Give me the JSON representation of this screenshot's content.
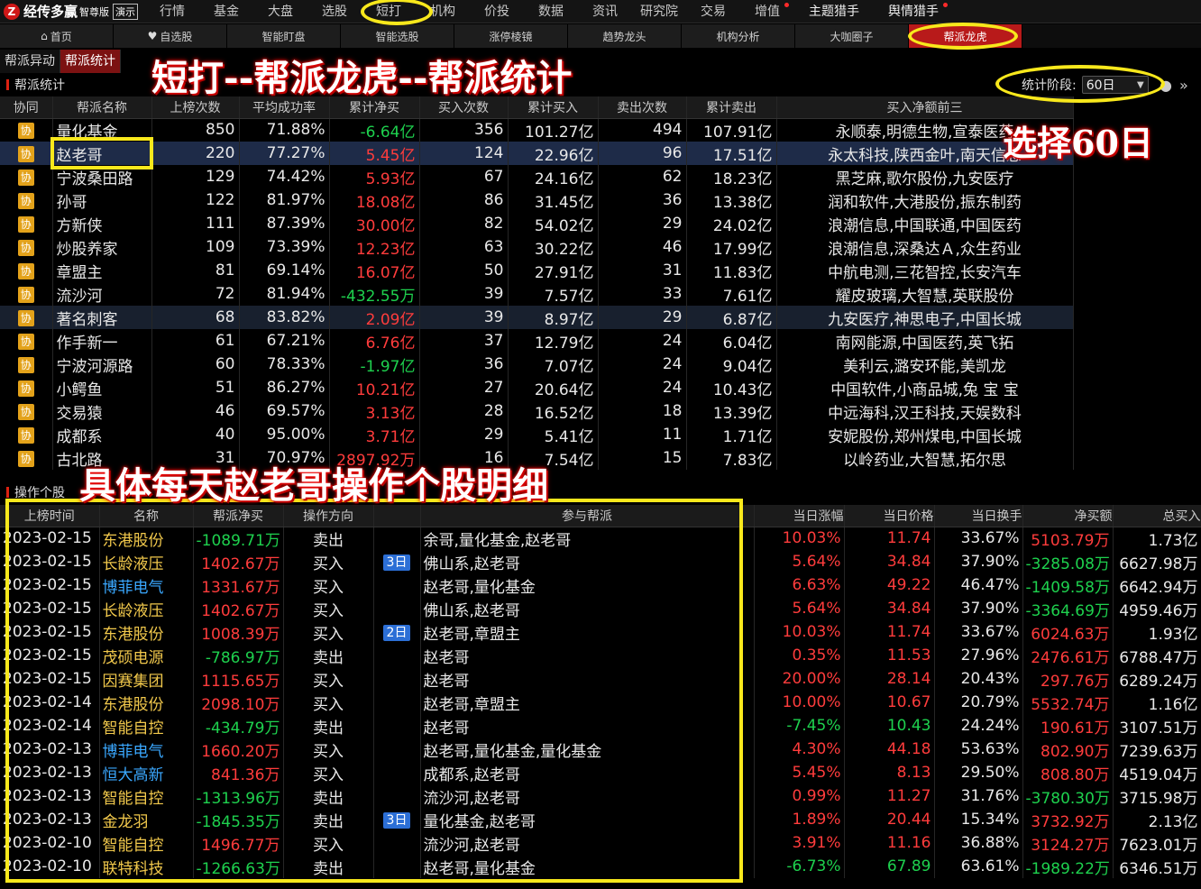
{
  "app": {
    "logo_glyph": "Z",
    "name": "经传多赢",
    "edition": "智尊版",
    "demo": "演示"
  },
  "menu": [
    "行情",
    "基金",
    "大盘",
    "选股",
    "短打",
    "机构",
    "价投",
    "数据",
    "资讯",
    "研究院",
    "交易",
    "增值",
    "主题猎手",
    "舆情猎手"
  ],
  "tabs": [
    {
      "icon": "⌂",
      "label": "首页"
    },
    {
      "icon": "♥",
      "label": "自选股"
    },
    {
      "label": "智能盯盘"
    },
    {
      "label": "智能选股"
    },
    {
      "label": "涨停棱镜"
    },
    {
      "label": "趋势龙头"
    },
    {
      "label": "机构分析"
    },
    {
      "label": "大咖圈子"
    },
    {
      "label": "帮派龙虎"
    }
  ],
  "subtabs": [
    "帮派异动",
    "帮派统计"
  ],
  "annotations": {
    "title": "短打--帮派龙虎--帮派统计",
    "select60": "选择60日",
    "detail": "具体每天赵老哥操作个股明细"
  },
  "section1": {
    "title": "帮派统计",
    "period_label": "统计阶段:",
    "period_value": "60日"
  },
  "gang_table": {
    "headers": [
      "协同",
      "帮派名称",
      "上榜次数",
      "平均成功率",
      "累计净买",
      "买入次数",
      "累计买入",
      "卖出次数",
      "累计卖出",
      "买入净额前三"
    ],
    "tag": "协",
    "rows": [
      {
        "name": "量化基金",
        "times": "850",
        "rate": "71.88%",
        "net": "-6.64亿",
        "net_dir": "dn",
        "buy_n": "356",
        "buy_amt": "101.27亿",
        "sell_n": "494",
        "sell_amt": "107.91亿",
        "top3": "永顺泰,明德生物,宣泰医药"
      },
      {
        "name": "赵老哥",
        "times": "220",
        "rate": "77.27%",
        "net": "5.45亿",
        "net_dir": "up",
        "buy_n": "124",
        "buy_amt": "22.96亿",
        "sell_n": "96",
        "sell_amt": "17.51亿",
        "top3": "永太科技,陕西金叶,南天信息"
      },
      {
        "name": "宁波桑田路",
        "times": "129",
        "rate": "74.42%",
        "net": "5.93亿",
        "net_dir": "up",
        "buy_n": "67",
        "buy_amt": "24.16亿",
        "sell_n": "62",
        "sell_amt": "18.23亿",
        "top3": "黑芝麻,歌尔股份,九安医疗"
      },
      {
        "name": "孙哥",
        "times": "122",
        "rate": "81.97%",
        "net": "18.08亿",
        "net_dir": "up",
        "buy_n": "86",
        "buy_amt": "31.45亿",
        "sell_n": "36",
        "sell_amt": "13.38亿",
        "top3": "润和软件,大港股份,振东制药"
      },
      {
        "name": "方新侠",
        "times": "111",
        "rate": "87.39%",
        "net": "30.00亿",
        "net_dir": "up",
        "buy_n": "82",
        "buy_amt": "54.02亿",
        "sell_n": "29",
        "sell_amt": "24.02亿",
        "top3": "浪潮信息,中国联通,中国医药"
      },
      {
        "name": "炒股养家",
        "times": "109",
        "rate": "73.39%",
        "net": "12.23亿",
        "net_dir": "up",
        "buy_n": "63",
        "buy_amt": "30.22亿",
        "sell_n": "46",
        "sell_amt": "17.99亿",
        "top3": "浪潮信息,深桑达Ａ,众生药业"
      },
      {
        "name": "章盟主",
        "times": "81",
        "rate": "69.14%",
        "net": "16.07亿",
        "net_dir": "up",
        "buy_n": "50",
        "buy_amt": "27.91亿",
        "sell_n": "31",
        "sell_amt": "11.83亿",
        "top3": "中航电测,三花智控,长安汽车"
      },
      {
        "name": "流沙河",
        "times": "72",
        "rate": "81.94%",
        "net": "-432.55万",
        "net_dir": "dn",
        "buy_n": "39",
        "buy_amt": "7.57亿",
        "sell_n": "33",
        "sell_amt": "7.61亿",
        "top3": "耀皮玻璃,大智慧,英联股份"
      },
      {
        "name": "著名刺客",
        "times": "68",
        "rate": "83.82%",
        "net": "2.09亿",
        "net_dir": "up",
        "buy_n": "39",
        "buy_amt": "8.97亿",
        "sell_n": "29",
        "sell_amt": "6.87亿",
        "top3": "九安医疗,神思电子,中国长城"
      },
      {
        "name": "作手新一",
        "times": "61",
        "rate": "67.21%",
        "net": "6.76亿",
        "net_dir": "up",
        "buy_n": "37",
        "buy_amt": "12.79亿",
        "sell_n": "24",
        "sell_amt": "6.04亿",
        "top3": "南网能源,中国医药,英飞拓"
      },
      {
        "name": "宁波河源路",
        "times": "60",
        "rate": "78.33%",
        "net": "-1.97亿",
        "net_dir": "dn",
        "buy_n": "36",
        "buy_amt": "7.07亿",
        "sell_n": "24",
        "sell_amt": "9.04亿",
        "top3": "美利云,潞安环能,美凯龙"
      },
      {
        "name": "小鳄鱼",
        "times": "51",
        "rate": "86.27%",
        "net": "10.21亿",
        "net_dir": "up",
        "buy_n": "27",
        "buy_amt": "20.64亿",
        "sell_n": "24",
        "sell_amt": "10.43亿",
        "top3": "中国软件,小商品城,兔 宝 宝"
      },
      {
        "name": "交易猿",
        "times": "46",
        "rate": "69.57%",
        "net": "3.13亿",
        "net_dir": "up",
        "buy_n": "28",
        "buy_amt": "16.52亿",
        "sell_n": "18",
        "sell_amt": "13.39亿",
        "top3": "中远海科,汉王科技,天娱数科"
      },
      {
        "name": "成都系",
        "times": "40",
        "rate": "95.00%",
        "net": "3.71亿",
        "net_dir": "up",
        "buy_n": "29",
        "buy_amt": "5.41亿",
        "sell_n": "11",
        "sell_amt": "1.71亿",
        "top3": "安妮股份,郑州煤电,中国长城"
      },
      {
        "name": "古北路",
        "times": "31",
        "rate": "70.97%",
        "net": "2897.92万",
        "net_dir": "up",
        "buy_n": "16",
        "buy_amt": "7.54亿",
        "sell_n": "15",
        "sell_amt": "7.83亿",
        "top3": "以岭药业,大智慧,拓尔思"
      }
    ]
  },
  "section2": {
    "title": "操作个股"
  },
  "detail_table": {
    "headers": [
      "上榜时间",
      "名称",
      "帮派净买",
      "操作方向",
      "",
      "参与帮派",
      "当日涨幅",
      "当日价格",
      "当日换手",
      "净买额",
      "总买入"
    ],
    "rows": [
      {
        "date": "2023-02-15",
        "stock": "东港股份",
        "sc": "yl",
        "gnet": "-1089.71万",
        "gd": "dn",
        "dir": "卖出",
        "badge": "",
        "gangs": "余哥,量化基金,赵老哥",
        "chg": "10.03%",
        "cd": "up",
        "price": "11.74",
        "pd": "up",
        "turn": "33.67%",
        "net": "5103.79万",
        "nd": "up",
        "total": "1.73亿"
      },
      {
        "date": "2023-02-15",
        "stock": "长龄液压",
        "sc": "yl",
        "gnet": "1402.67万",
        "gd": "up",
        "dir": "买入",
        "badge": "3日",
        "gangs": "佛山系,赵老哥",
        "chg": "5.64%",
        "cd": "up",
        "price": "34.84",
        "pd": "up",
        "turn": "37.90%",
        "net": "-3285.08万",
        "nd": "dn",
        "total": "6627.98万"
      },
      {
        "date": "2023-02-15",
        "stock": "博菲电气",
        "sc": "bl",
        "gnet": "1331.67万",
        "gd": "up",
        "dir": "买入",
        "badge": "",
        "gangs": "赵老哥,量化基金",
        "chg": "6.63%",
        "cd": "up",
        "price": "49.22",
        "pd": "up",
        "turn": "46.47%",
        "net": "-1409.58万",
        "nd": "dn",
        "total": "6642.94万"
      },
      {
        "date": "2023-02-15",
        "stock": "长龄液压",
        "sc": "yl",
        "gnet": "1402.67万",
        "gd": "up",
        "dir": "买入",
        "badge": "",
        "gangs": "佛山系,赵老哥",
        "chg": "5.64%",
        "cd": "up",
        "price": "34.84",
        "pd": "up",
        "turn": "37.90%",
        "net": "-3364.69万",
        "nd": "dn",
        "total": "4959.46万"
      },
      {
        "date": "2023-02-15",
        "stock": "东港股份",
        "sc": "yl",
        "gnet": "1008.39万",
        "gd": "up",
        "dir": "买入",
        "badge": "2日",
        "gangs": "赵老哥,章盟主",
        "chg": "10.03%",
        "cd": "up",
        "price": "11.74",
        "pd": "up",
        "turn": "33.67%",
        "net": "6024.63万",
        "nd": "up",
        "total": "1.93亿"
      },
      {
        "date": "2023-02-15",
        "stock": "茂硕电源",
        "sc": "yl",
        "gnet": "-786.97万",
        "gd": "dn",
        "dir": "卖出",
        "badge": "",
        "gangs": "赵老哥",
        "chg": "0.35%",
        "cd": "up",
        "price": "11.53",
        "pd": "up",
        "turn": "27.96%",
        "net": "2476.61万",
        "nd": "up",
        "total": "6788.47万"
      },
      {
        "date": "2023-02-15",
        "stock": "因赛集团",
        "sc": "yl",
        "gnet": "1115.65万",
        "gd": "up",
        "dir": "买入",
        "badge": "",
        "gangs": "赵老哥",
        "chg": "20.00%",
        "cd": "up",
        "price": "28.14",
        "pd": "up",
        "turn": "20.43%",
        "net": "297.76万",
        "nd": "up",
        "total": "6289.24万"
      },
      {
        "date": "2023-02-14",
        "stock": "东港股份",
        "sc": "yl",
        "gnet": "2098.10万",
        "gd": "up",
        "dir": "买入",
        "badge": "",
        "gangs": "赵老哥,章盟主",
        "chg": "10.00%",
        "cd": "up",
        "price": "10.67",
        "pd": "up",
        "turn": "20.79%",
        "net": "5532.74万",
        "nd": "up",
        "total": "1.16亿"
      },
      {
        "date": "2023-02-14",
        "stock": "智能自控",
        "sc": "yl",
        "gnet": "-434.79万",
        "gd": "dn",
        "dir": "卖出",
        "badge": "",
        "gangs": "赵老哥",
        "chg": "-7.45%",
        "cd": "dn",
        "price": "10.43",
        "pd": "dn",
        "turn": "24.24%",
        "net": "190.61万",
        "nd": "up",
        "total": "3107.51万"
      },
      {
        "date": "2023-02-13",
        "stock": "博菲电气",
        "sc": "bl",
        "gnet": "1660.20万",
        "gd": "up",
        "dir": "买入",
        "badge": "",
        "gangs": "赵老哥,量化基金,量化基金",
        "chg": "4.30%",
        "cd": "up",
        "price": "44.18",
        "pd": "up",
        "turn": "53.63%",
        "net": "802.90万",
        "nd": "up",
        "total": "7239.63万"
      },
      {
        "date": "2023-02-13",
        "stock": "恒大高新",
        "sc": "bl",
        "gnet": "841.36万",
        "gd": "up",
        "dir": "买入",
        "badge": "",
        "gangs": "成都系,赵老哥",
        "chg": "5.45%",
        "cd": "up",
        "price": "8.13",
        "pd": "up",
        "turn": "29.50%",
        "net": "808.80万",
        "nd": "up",
        "total": "4519.04万"
      },
      {
        "date": "2023-02-13",
        "stock": "智能自控",
        "sc": "yl",
        "gnet": "-1313.96万",
        "gd": "dn",
        "dir": "卖出",
        "badge": "",
        "gangs": "流沙河,赵老哥",
        "chg": "0.99%",
        "cd": "up",
        "price": "11.27",
        "pd": "up",
        "turn": "31.76%",
        "net": "-3780.30万",
        "nd": "dn",
        "total": "3715.98万"
      },
      {
        "date": "2023-02-13",
        "stock": "金龙羽",
        "sc": "yl",
        "gnet": "-1845.35万",
        "gd": "dn",
        "dir": "卖出",
        "badge": "3日",
        "gangs": "量化基金,赵老哥",
        "chg": "1.89%",
        "cd": "up",
        "price": "20.44",
        "pd": "up",
        "turn": "15.34%",
        "net": "3732.92万",
        "nd": "up",
        "total": "2.13亿"
      },
      {
        "date": "2023-02-10",
        "stock": "智能自控",
        "sc": "yl",
        "gnet": "1496.77万",
        "gd": "up",
        "dir": "买入",
        "badge": "",
        "gangs": "流沙河,赵老哥",
        "chg": "3.91%",
        "cd": "up",
        "price": "11.16",
        "pd": "up",
        "turn": "36.88%",
        "net": "3124.27万",
        "nd": "up",
        "total": "7623.01万"
      },
      {
        "date": "2023-02-10",
        "stock": "联特科技",
        "sc": "yl",
        "gnet": "-1266.63万",
        "gd": "dn",
        "dir": "卖出",
        "badge": "",
        "gangs": "赵老哥,量化基金",
        "chg": "-6.73%",
        "cd": "dn",
        "price": "67.89",
        "pd": "dn",
        "turn": "63.61%",
        "net": "-1989.22万",
        "nd": "dn",
        "total": "6346.51万"
      }
    ]
  },
  "colors": {
    "up": "#ff3c3c",
    "down": "#1ed14e",
    "accent": "#b81a1a",
    "annotation": "#f8e81c"
  }
}
